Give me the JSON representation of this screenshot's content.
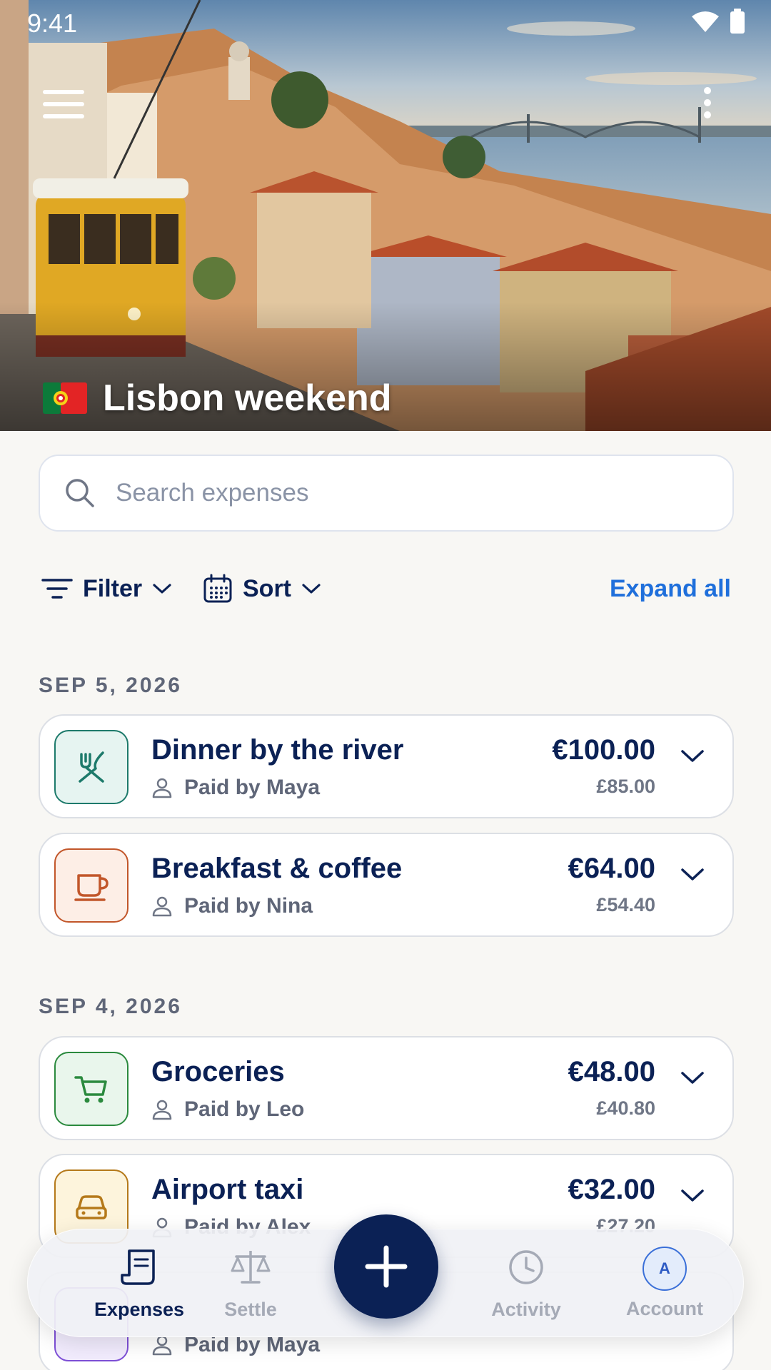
{
  "status": {
    "time": "9:41"
  },
  "trip": {
    "title": "Lisbon weekend"
  },
  "search": {
    "placeholder": "Search expenses"
  },
  "toolbar": {
    "filter_label": "Filter",
    "sort_label": "Sort",
    "expand_label": "Expand all"
  },
  "groups": [
    {
      "date": "SEP 5, 2026",
      "items": [
        {
          "title": "Dinner by the river",
          "paid_by": "Paid by Maya",
          "amount": "€100.00",
          "converted": "£85.00",
          "icon": "utensils-icon",
          "color": "#1d7a6b"
        },
        {
          "title": "Breakfast & coffee",
          "paid_by": "Paid by Nina",
          "amount": "€64.00",
          "converted": "£54.40",
          "icon": "coffee-cup-icon",
          "color": "#c2562a"
        }
      ]
    },
    {
      "date": "SEP 4, 2026",
      "items": [
        {
          "title": "Groceries",
          "paid_by": "Paid by Leo",
          "amount": "€48.00",
          "converted": "£40.80",
          "icon": "shopping-cart-icon",
          "color": "#2b8a3e"
        },
        {
          "title": "Airport taxi",
          "paid_by": "Paid by Alex",
          "amount": "€32.00",
          "converted": "£27.20",
          "icon": "car-icon",
          "color": "#b5791a"
        },
        {
          "title": "",
          "paid_by": "Paid by Maya",
          "amount": "",
          "converted": "",
          "icon": "receipt-icon",
          "color": "#7d4fd6"
        }
      ]
    }
  ],
  "nav": {
    "expenses": "Expenses",
    "settle": "Settle",
    "activity": "Activity",
    "account": "Account",
    "account_initial": "A"
  },
  "colors": {
    "navy": "#0b2155",
    "accent": "#1f6fdb",
    "background": "#f8f7f4"
  }
}
